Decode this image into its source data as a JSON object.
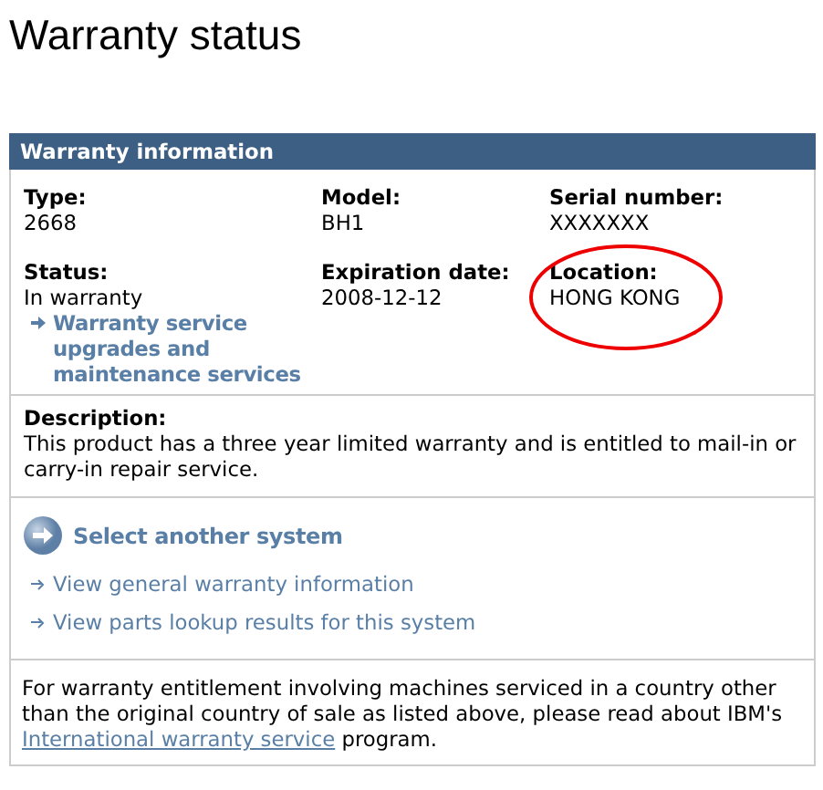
{
  "page_title": "Warranty status",
  "panel": {
    "title": "Warranty information",
    "fields": [
      {
        "label": "Type:",
        "value": "2668",
        "circled": false
      },
      {
        "label": "Model:",
        "value": "BH1",
        "circled": false
      },
      {
        "label": "Serial number:",
        "value": "XXXXXXX",
        "circled": false
      },
      {
        "label": "Status:",
        "value": "In warranty",
        "link": "Warranty service upgrades and maintenance services",
        "circled": false
      },
      {
        "label": "Expiration date:",
        "value": "2008-12-12",
        "circled": false
      },
      {
        "label": "Location:",
        "value": "HONG KONG",
        "circled": true
      }
    ],
    "description": {
      "label": "Description:",
      "text": "This product has a three year limited warranty and is entitled to mail-in or carry-in repair service."
    },
    "primary_link": "Select another system",
    "links": [
      "View general warranty information",
      "View parts lookup results for this system"
    ],
    "note": {
      "before": "For warranty entitlement involving machines serviced in a country other than the original country of sale as listed above, please read about IBM's ",
      "link": "International warranty service",
      "after": " program."
    }
  }
}
